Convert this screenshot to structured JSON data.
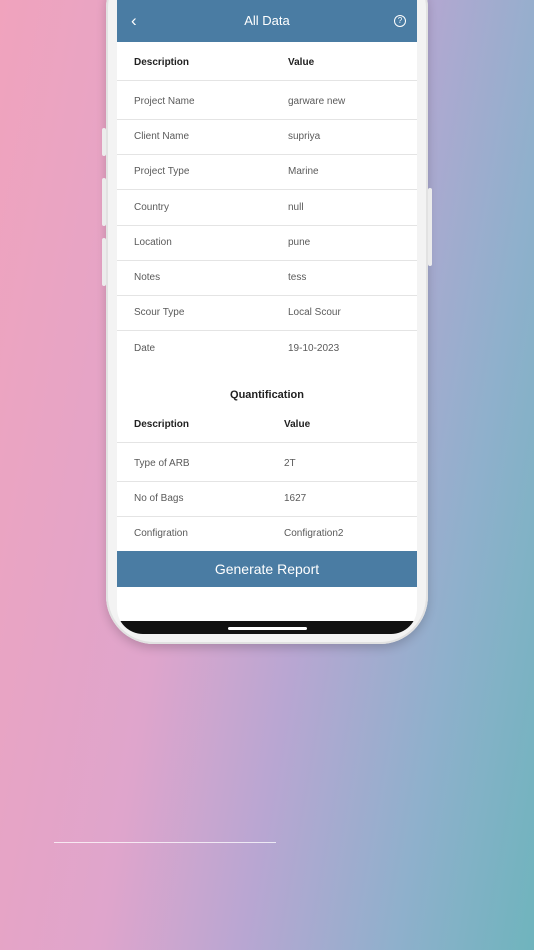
{
  "appbar": {
    "title": "All Data",
    "back_icon": "‹",
    "help_icon": "?"
  },
  "details": {
    "header": {
      "description": "Description",
      "value": "Value"
    },
    "rows": [
      {
        "label": "Project Name",
        "value": "garware new"
      },
      {
        "label": "Client Name",
        "value": "supriya"
      },
      {
        "label": "Project Type",
        "value": "Marine"
      },
      {
        "label": "Country",
        "value": "null"
      },
      {
        "label": "Location",
        "value": "pune"
      },
      {
        "label": "Notes",
        "value": "tess"
      },
      {
        "label": "Scour Type",
        "value": "Local Scour"
      },
      {
        "label": "Date",
        "value": "19-10-2023"
      }
    ]
  },
  "quantification": {
    "title": "Quantification",
    "header": {
      "description": "Description",
      "value": "Value"
    },
    "rows": [
      {
        "label": "Type of ARB",
        "value": "2T"
      },
      {
        "label": "No of Bags",
        "value": "1627"
      },
      {
        "label": "Configration",
        "value": "Configration2"
      }
    ]
  },
  "actions": {
    "generate_label": "Generate Report"
  },
  "colors": {
    "primary": "#4a7ca3"
  }
}
